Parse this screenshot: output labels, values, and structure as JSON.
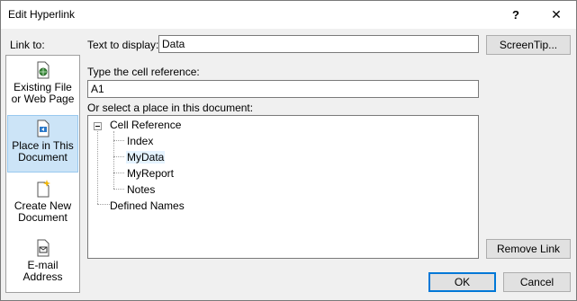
{
  "window": {
    "title": "Edit Hyperlink",
    "help_glyph": "?",
    "close_glyph": "✕"
  },
  "link_to": {
    "label": "Link to:",
    "items": [
      {
        "line1": "Existing File",
        "line2": "or Web Page",
        "icon": "globe-file-icon"
      },
      {
        "line1": "Place in This",
        "line2": "Document",
        "icon": "document-place-icon",
        "active": true
      },
      {
        "line1": "Create New",
        "line2": "Document",
        "icon": "new-document-icon"
      },
      {
        "line1": "E-mail",
        "line2": "Address",
        "icon": "email-icon"
      }
    ]
  },
  "text_to_display": {
    "label": "Text to display:",
    "value": "Data"
  },
  "screentip": {
    "label": "ScreenTip..."
  },
  "cell_reference": {
    "label": "Type the cell reference:",
    "value": "A1"
  },
  "place_label": "Or select a place in this document:",
  "tree": {
    "root": "Cell Reference",
    "children": [
      "Index",
      "MyData",
      "MyReport",
      "Notes"
    ],
    "selected": "MyData",
    "second_root": "Defined Names"
  },
  "remove_link": {
    "label": "Remove Link"
  },
  "ok": {
    "label": "OK"
  },
  "cancel": {
    "label": "Cancel"
  }
}
